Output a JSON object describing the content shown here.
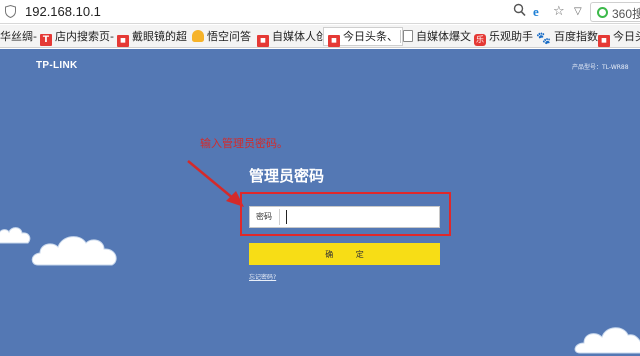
{
  "browser": {
    "url": "192.168.10.1",
    "search_placeholder": "360搜",
    "icons": {
      "shield": "shield-icon",
      "search": "search-icon",
      "ie": "ie-compat-icon",
      "star": "star-icon",
      "chevron": "chevron-down-icon",
      "search_logo": "360-search-logo"
    }
  },
  "bookmarks": [
    {
      "label": "华丝绸-",
      "icon": "none"
    },
    {
      "label": "店内搜索页-",
      "icon": "t-logo"
    },
    {
      "label": "戴眼镜的超",
      "icon": "badge"
    },
    {
      "label": "悟空问答",
      "icon": "wukong"
    },
    {
      "label": "自媒体人创",
      "icon": "badge"
    },
    {
      "label": "今日头条、",
      "icon": "badge"
    },
    {
      "label": "自媒体爆文",
      "icon": "doc"
    },
    {
      "label": "乐观助手",
      "icon": "le"
    },
    {
      "label": "百度指数",
      "icon": "paw"
    },
    {
      "label": "今日头条",
      "icon": "badge"
    }
  ],
  "router": {
    "brand": "TP-LINK",
    "model": "产品型号：TL-WR88",
    "annotation": "输入管理员密码。",
    "title": "管理员密码",
    "password_label": "密码",
    "password_value": "",
    "confirm_button": "确 定",
    "forgot_link": "忘记密码?",
    "colors": {
      "background": "#5478b4",
      "button": "#f7dd16",
      "annotation": "#d42a2a",
      "highlight_frame": "#e0282a"
    }
  }
}
